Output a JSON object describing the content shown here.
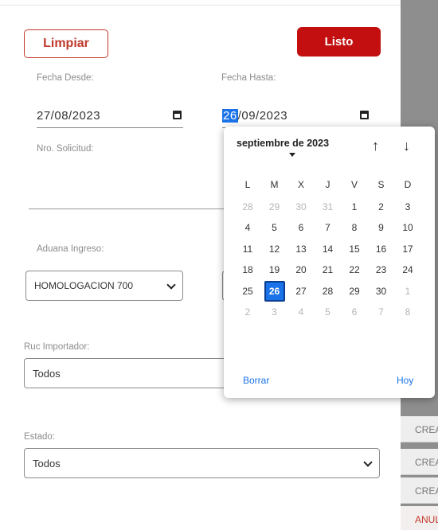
{
  "toolbar": {
    "clear_label": "Limpiar",
    "done_label": "Listo"
  },
  "filters": {
    "date_from_label": "Fecha Desde:",
    "date_from_value": "27/08/2023",
    "date_to_label": "Fecha Hasta:",
    "date_to_day": "26",
    "date_to_rest": "/09/2023",
    "request_no_label": "Nro. Solicitud:",
    "customs_label": "Aduana Ingreso:",
    "customs_value": "HOMOLOGACION 700",
    "importer_label": "Ruc Importador:",
    "importer_value": "Todos",
    "status_label": "Estado:",
    "status_value": "Todos"
  },
  "datepicker": {
    "month_label": "septiembre de 2023",
    "weekdays": [
      "L",
      "M",
      "X",
      "J",
      "V",
      "S",
      "D"
    ],
    "weeks": [
      [
        {
          "d": "28",
          "dim": true
        },
        {
          "d": "29",
          "dim": true
        },
        {
          "d": "30",
          "dim": true
        },
        {
          "d": "31",
          "dim": true
        },
        {
          "d": "1"
        },
        {
          "d": "2"
        },
        {
          "d": "3"
        }
      ],
      [
        {
          "d": "4"
        },
        {
          "d": "5"
        },
        {
          "d": "6"
        },
        {
          "d": "7"
        },
        {
          "d": "8"
        },
        {
          "d": "9"
        },
        {
          "d": "10"
        }
      ],
      [
        {
          "d": "11"
        },
        {
          "d": "12"
        },
        {
          "d": "13"
        },
        {
          "d": "14"
        },
        {
          "d": "15"
        },
        {
          "d": "16"
        },
        {
          "d": "17"
        }
      ],
      [
        {
          "d": "18"
        },
        {
          "d": "19"
        },
        {
          "d": "20"
        },
        {
          "d": "21"
        },
        {
          "d": "22"
        },
        {
          "d": "23"
        },
        {
          "d": "24"
        }
      ],
      [
        {
          "d": "25"
        },
        {
          "d": "26",
          "sel": true
        },
        {
          "d": "27"
        },
        {
          "d": "28"
        },
        {
          "d": "29"
        },
        {
          "d": "30"
        },
        {
          "d": "1",
          "dim": true
        }
      ],
      [
        {
          "d": "2",
          "dim": true
        },
        {
          "d": "3",
          "dim": true
        },
        {
          "d": "4",
          "dim": true
        },
        {
          "d": "5",
          "dim": true
        },
        {
          "d": "6",
          "dim": true
        },
        {
          "d": "7",
          "dim": true
        },
        {
          "d": "8",
          "dim": true
        }
      ]
    ],
    "clear_label": "Borrar",
    "today_label": "Hoy",
    "prev_icon": "arrow-up-icon",
    "next_icon": "arrow-down-icon"
  },
  "background_table": {
    "rows": [
      {
        "text": "CREA",
        "status": "normal"
      },
      {
        "text": "CREA",
        "status": "normal"
      },
      {
        "text": "CREA",
        "status": "normal"
      },
      {
        "text": "ANUL",
        "status": "red"
      }
    ]
  },
  "colors": {
    "accent": "#c30f0f",
    "link": "#1a73e8",
    "selected_day": "#1a73e8"
  }
}
